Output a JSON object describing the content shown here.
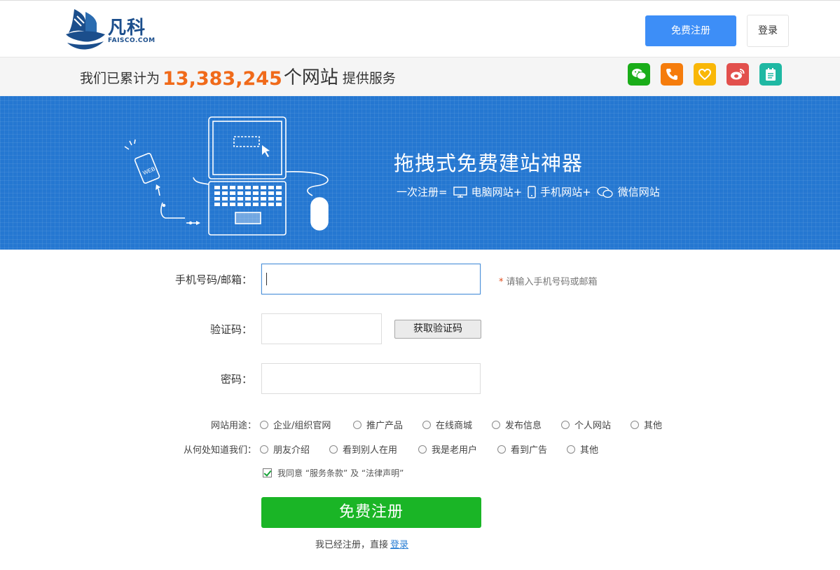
{
  "header": {
    "logo_text": "凡科",
    "logo_sub": "FAISCO.COM",
    "register_label": "免费注册",
    "login_label": "登录"
  },
  "stats": {
    "prefix": "我们已累计为",
    "count": "13,383,245",
    "unit": "个网站",
    "suffix": "提供服务"
  },
  "social": [
    {
      "name": "wechat-icon",
      "color": "#1aad19"
    },
    {
      "name": "phone-icon",
      "color": "#f57c0c"
    },
    {
      "name": "heart-icon",
      "color": "#f9b707"
    },
    {
      "name": "weibo-icon",
      "color": "#e2504d"
    },
    {
      "name": "notepad-icon",
      "color": "#1fb8a3"
    }
  ],
  "banner": {
    "title": "拖拽式免费建站神器",
    "sub_prefix": "一次注册=",
    "sub_pc": "电脑网站+",
    "sub_mobile": "手机网站+",
    "sub_wechat": "微信网站",
    "phone_label": "WEB"
  },
  "form": {
    "phone_label": "手机号码/邮箱：",
    "phone_value": "",
    "phone_hint_star": "*",
    "phone_hint": "请输入手机号码或邮箱",
    "code_label": "验证码：",
    "code_value": "",
    "get_code_label": "获取验证码",
    "password_label": "密码：",
    "password_value": "",
    "usage_label": "网站用途：",
    "usage_options": [
      "企业/组织官网",
      "推广产品",
      "在线商城",
      "发布信息",
      "个人网站",
      "其他"
    ],
    "source_label": "从何处知道我们：",
    "source_options": [
      "朋友介绍",
      "看到别人在用",
      "我是老用户",
      "看到广告",
      "其他"
    ],
    "agree_text": "我同意 “服务条款” 及 “法律声明”",
    "agree_checked": true,
    "submit_label": "免费注册",
    "already_text": "我已经注册，直接",
    "already_link": "登录"
  }
}
